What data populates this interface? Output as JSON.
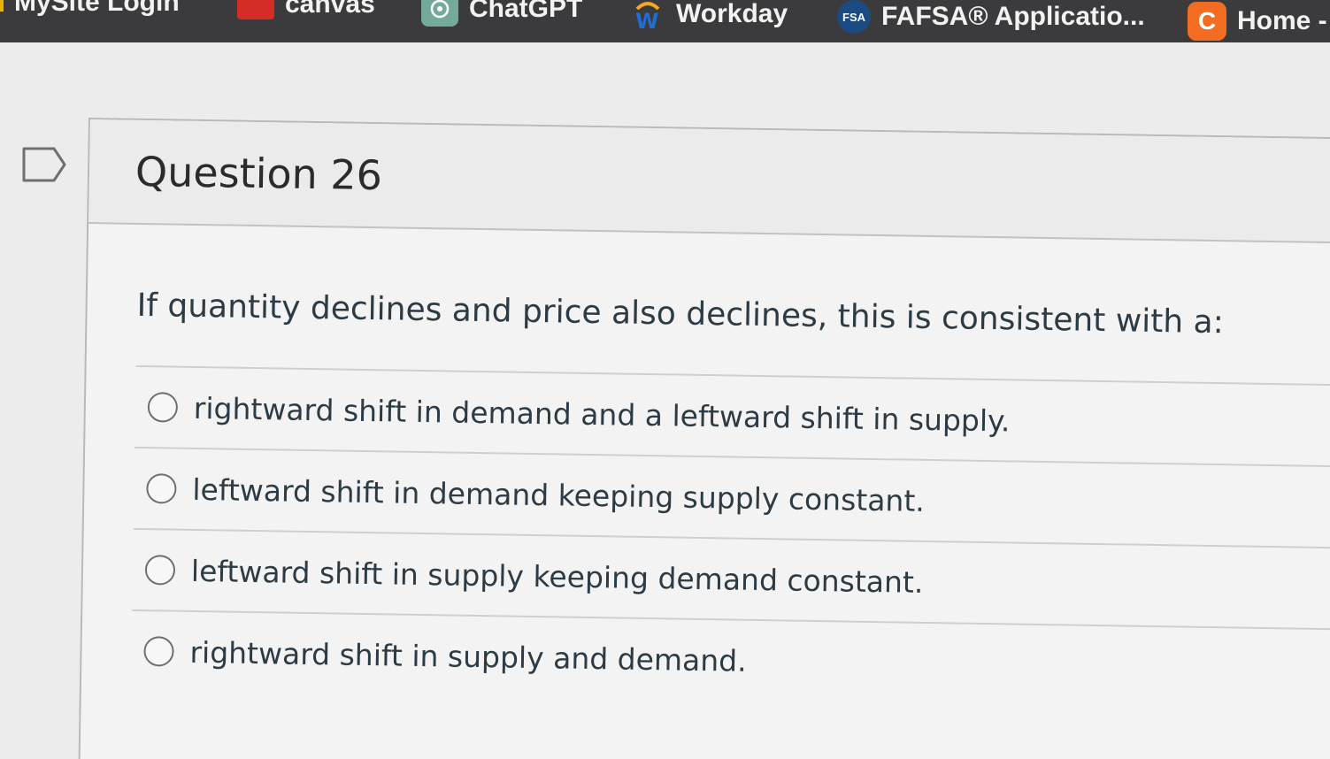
{
  "bookmarks": [
    {
      "label": "MySite Login",
      "icon": "mysite-icon",
      "color": "#e8b400"
    },
    {
      "label": "canvas",
      "icon": "canvas-icon",
      "color": "#d32d26"
    },
    {
      "label": "ChatGPT",
      "icon": "chatgpt-icon",
      "color": "#74aa9c"
    },
    {
      "label": "Workday",
      "icon": "workday-icon",
      "color": "#f5a623"
    },
    {
      "label": "FAFSA® Applicatio...",
      "icon": "fsa-icon",
      "icon_text": "FSA",
      "color": "#1c4b82"
    },
    {
      "label": "Home -",
      "icon": "c-icon",
      "icon_text": "C",
      "color": "#f26c21"
    }
  ],
  "question": {
    "title": "Question 26",
    "text": "If quantity declines and price also declines, this is consistent with a:",
    "answers": [
      "rightward shift in demand and a leftward shift in supply.",
      "leftward shift in demand keeping supply constant.",
      "leftward shift in supply keeping demand constant.",
      "rightward shift in supply and demand."
    ]
  }
}
